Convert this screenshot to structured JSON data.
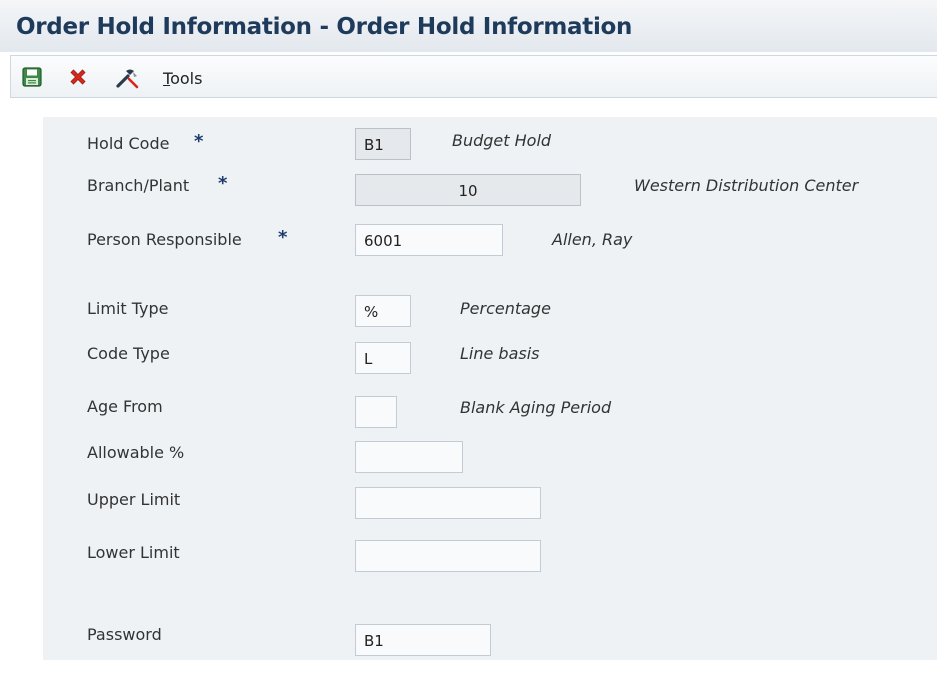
{
  "window": {
    "title": "Order Hold Information - Order Hold Information"
  },
  "toolbar": {
    "save_icon": "save-icon",
    "close_icon": "close-icon",
    "tools_icon": "tools-icon",
    "tools_mnemonic": "T",
    "tools_rest": "ools"
  },
  "form": {
    "required_marker": "*",
    "hold_code": {
      "label": "Hold Code",
      "value": "B1",
      "description": "Budget Hold"
    },
    "branch_plant": {
      "label": "Branch/Plant",
      "value": "10",
      "description": "Western Distribution Center"
    },
    "person_responsible": {
      "label": "Person Responsible",
      "value": "6001",
      "description": "Allen, Ray"
    },
    "limit_type": {
      "label": "Limit Type",
      "value": "%",
      "description": "Percentage"
    },
    "code_type": {
      "label": "Code Type",
      "value": "L",
      "description": "Line basis"
    },
    "age_from": {
      "label": "Age From",
      "value": "",
      "description": "Blank Aging Period"
    },
    "allowable_pct": {
      "label": "Allowable %",
      "value": ""
    },
    "upper_limit": {
      "label": "Upper Limit",
      "value": ""
    },
    "lower_limit": {
      "label": "Lower Limit",
      "value": ""
    },
    "password": {
      "label": "Password",
      "value": "B1"
    }
  },
  "colors": {
    "title": "#1e3b5c",
    "required_star": "#1e3b6c",
    "close_icon": "#d42a1e",
    "save_icon": "#2f7a3a",
    "form_background": "#eef2f5"
  }
}
